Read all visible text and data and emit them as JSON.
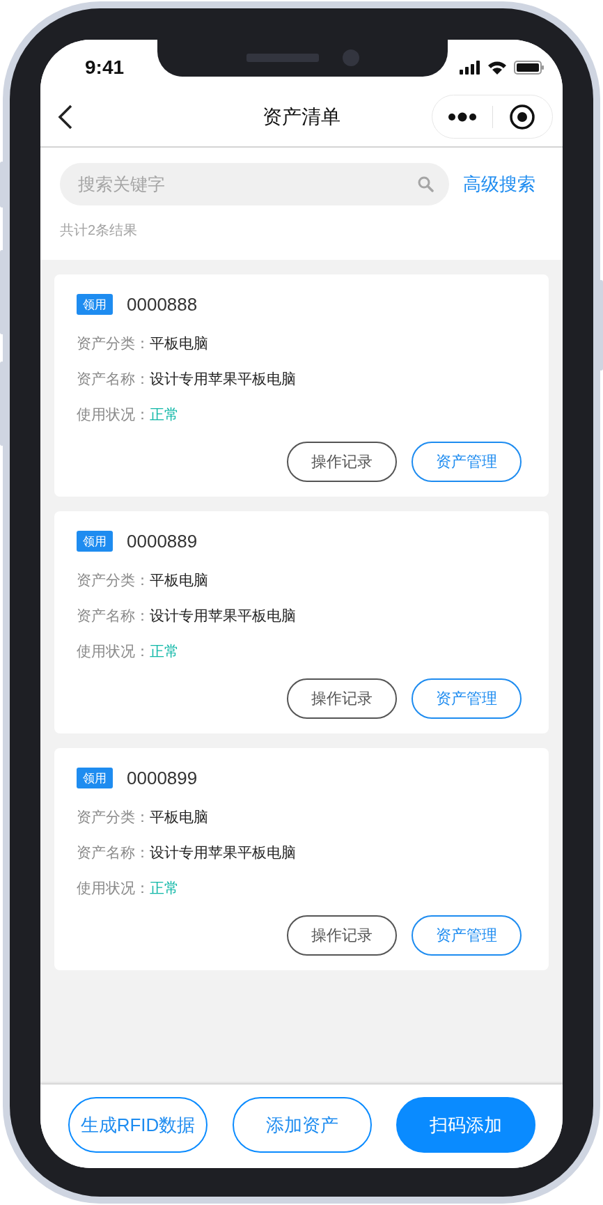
{
  "status_bar": {
    "time": "9:41"
  },
  "nav": {
    "title": "资产清单"
  },
  "search": {
    "placeholder": "搜索关键字",
    "advanced_link": "高级搜索"
  },
  "result_count": "共计2条结果",
  "assets": [
    {
      "tag": "领用",
      "id": "0000888",
      "fields": [
        {
          "label": "资产分类：",
          "value": "平板电脑",
          "kind": "plain"
        },
        {
          "label": "资产名称：",
          "value": "设计专用苹果平板电脑",
          "kind": "plain"
        },
        {
          "label": "使用状况：",
          "value": "正常",
          "kind": "status"
        }
      ],
      "actions": [
        {
          "label": "操作记录",
          "kind": "outline"
        },
        {
          "label": "资产管理",
          "kind": "primary"
        }
      ]
    },
    {
      "tag": "领用",
      "id": "0000889",
      "fields": [
        {
          "label": "资产分类：",
          "value": "平板电脑",
          "kind": "plain"
        },
        {
          "label": "资产名称：",
          "value": "设计专用苹果平板电脑",
          "kind": "plain"
        },
        {
          "label": "使用状况：",
          "value": "正常",
          "kind": "status"
        }
      ],
      "actions": [
        {
          "label": "操作记录",
          "kind": "outline"
        },
        {
          "label": "资产管理",
          "kind": "primary"
        }
      ]
    },
    {
      "tag": "领用",
      "id": "0000899",
      "fields": [
        {
          "label": "资产分类：",
          "value": "平板电脑",
          "kind": "plain"
        },
        {
          "label": "资产名称：",
          "value": "设计专用苹果平板电脑",
          "kind": "plain"
        },
        {
          "label": "使用状况：",
          "value": "正常",
          "kind": "status"
        }
      ],
      "actions": [
        {
          "label": "操作记录",
          "kind": "outline"
        },
        {
          "label": "资产管理",
          "kind": "primary"
        }
      ]
    }
  ],
  "bottom_actions": [
    {
      "label": "生成RFID数据",
      "kind": "outline"
    },
    {
      "label": "添加资产",
      "kind": "outline"
    },
    {
      "label": "扫码添加",
      "kind": "solid"
    }
  ]
}
